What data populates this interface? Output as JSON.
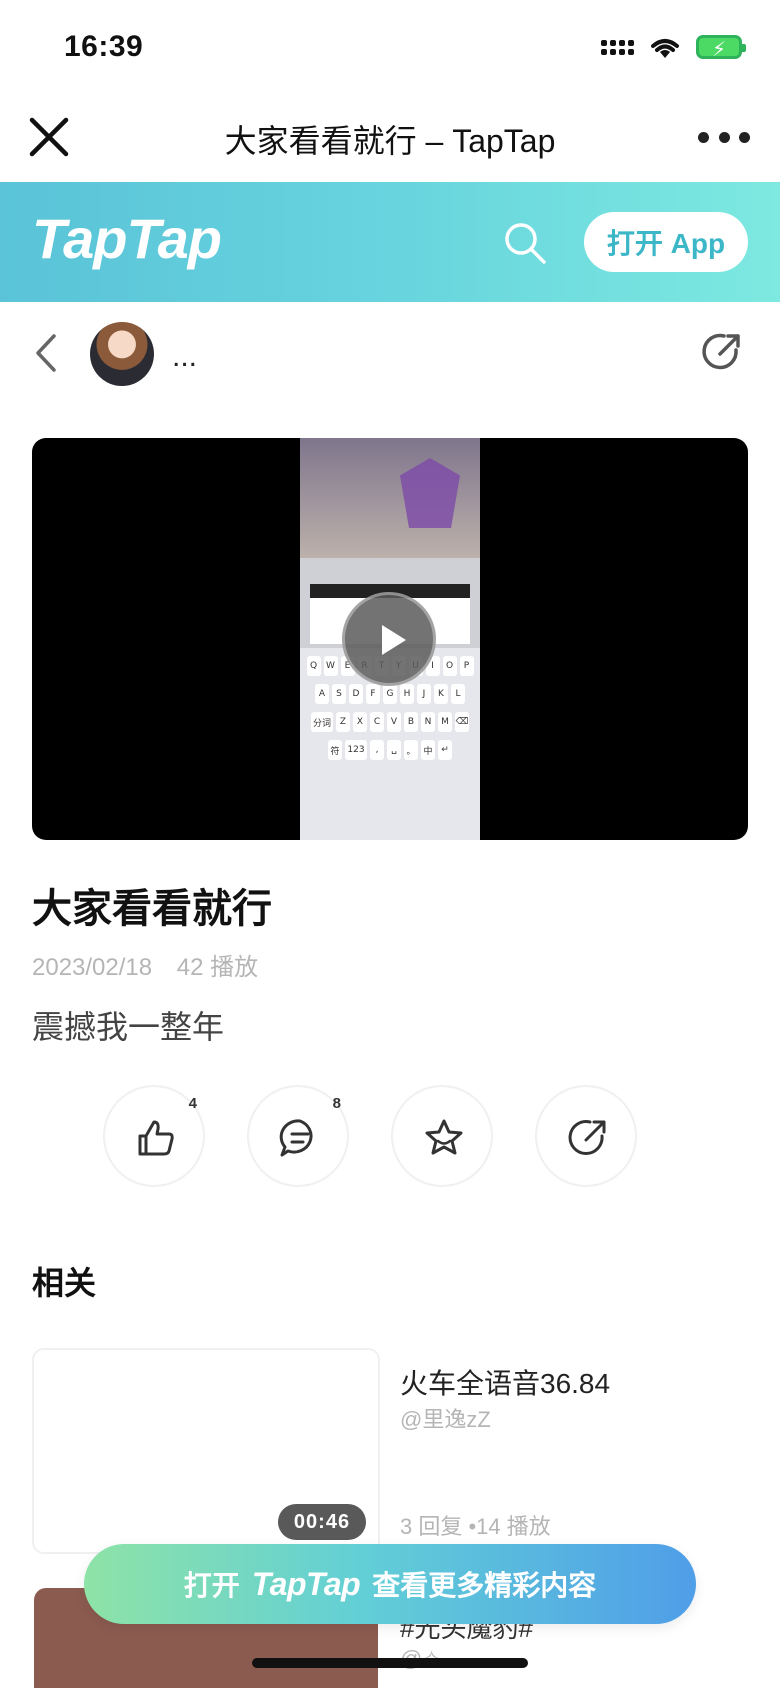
{
  "status_bar": {
    "time": "16:39"
  },
  "nav": {
    "title": "大家看看就行 – TapTap"
  },
  "header": {
    "logo": "TapTap",
    "open_app": "打开 App"
  },
  "author": {
    "name": "..."
  },
  "post": {
    "title": "大家看看就行",
    "date": "2023/02/18",
    "plays": "42 播放",
    "body": "震撼我一整年"
  },
  "actions": {
    "like_count": "4",
    "comment_count": "8"
  },
  "related": {
    "title": "相关",
    "items": [
      {
        "title": "火车全语音36.84",
        "author": "@里逸zZ",
        "stats": "3 回复 •14 播放",
        "duration": "00:46"
      },
      {
        "title": "#光头魔豹#",
        "author": "@✧"
      }
    ]
  },
  "banner": {
    "prefix": "打开",
    "logo": "TapTap",
    "suffix": "查看更多精彩内容"
  },
  "video": {
    "keyboard_rows": [
      [
        "Q",
        "W",
        "E",
        "R",
        "T",
        "Y",
        "U",
        "I",
        "O",
        "P"
      ],
      [
        "A",
        "S",
        "D",
        "F",
        "G",
        "H",
        "J",
        "K",
        "L"
      ],
      [
        "分词",
        "Z",
        "X",
        "C",
        "V",
        "B",
        "N",
        "M",
        "⌫"
      ],
      [
        "符",
        "123",
        ",",
        "␣",
        "。",
        "中",
        "↵"
      ]
    ]
  },
  "colors": {
    "accent": "#5ac3d8",
    "muted": "#b5b5b5"
  }
}
